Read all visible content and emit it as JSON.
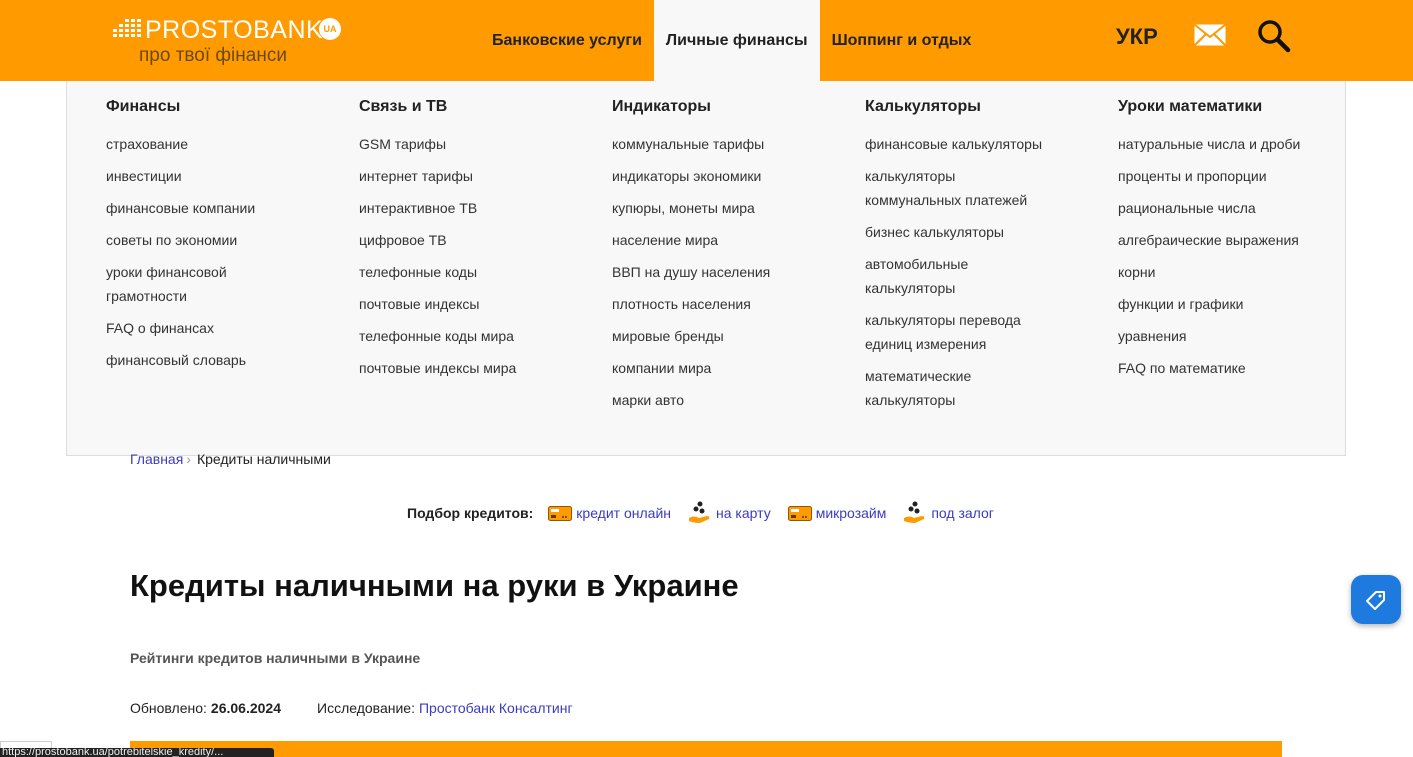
{
  "header": {
    "logo_text": "PROSTOBANK",
    "logo_badge": "UA",
    "slogan": "про твої фінанси",
    "nav": [
      {
        "label": "Банковские услуги",
        "active": false
      },
      {
        "label": "Личные финансы",
        "active": true
      },
      {
        "label": "Шоппинг и отдых",
        "active": false
      }
    ],
    "lang": "УКР",
    "colors": {
      "brand": "#ff9a00",
      "link": "#3b3bbf",
      "fab": "#1f7ae0"
    }
  },
  "mega": {
    "columns": [
      {
        "title": "Финансы",
        "links": [
          "страхование",
          "инвестиции",
          "финансовые компании",
          "советы по экономии",
          "уроки финансовой грамотности",
          "FAQ о финансах",
          "финансовый словарь"
        ]
      },
      {
        "title": "Связь и ТВ",
        "links": [
          "GSM тарифы",
          "интернет тарифы",
          "интерактивное ТВ",
          "цифровое ТВ",
          "телефонные коды",
          "почтовые индексы",
          "телефонные коды мира",
          "почтовые индексы мира"
        ]
      },
      {
        "title": "Индикаторы",
        "links": [
          "коммунальные тарифы",
          "индикаторы экономики",
          "купюры, монеты мира",
          "население мира",
          "ВВП на душу населения",
          "плотность населения",
          "мировые бренды",
          "компании мира",
          "марки авто"
        ]
      },
      {
        "title": "Калькуляторы",
        "links": [
          "финансовые калькуляторы",
          "калькуляторы коммунальных платежей",
          "бизнес калькуляторы",
          "автомобильные калькуляторы",
          "калькуляторы перевода единиц измерения",
          "математические калькуляторы"
        ]
      },
      {
        "title": "Уроки математики",
        "links": [
          "натуральные числа и дроби",
          "проценты и пропорции",
          "рациональные числа",
          "алгебраические выражения",
          "корни",
          "функции и графики",
          "уравнения",
          "FAQ по математике"
        ]
      }
    ]
  },
  "breadcrumb": {
    "home": "Главная",
    "sep": "›",
    "current": "Кредиты наличными"
  },
  "filters": {
    "label": "Подбор кредитов:",
    "items": [
      {
        "label": "кредит онлайн",
        "icon": "credit-card-icon"
      },
      {
        "label": "на карту",
        "icon": "hand-coins-icon"
      },
      {
        "label": "микрозайм",
        "icon": "credit-card-icon"
      },
      {
        "label": "под залог",
        "icon": "hand-coins-icon"
      }
    ]
  },
  "page": {
    "title": "Кредиты наличными на руки в Украине",
    "subtitle": "Рейтинги кредитов наличными в Украине",
    "updated_label": "Обновлено:",
    "updated_date": "26.06.2024",
    "research_label": "Исследование:",
    "research_link": "Простобанк Консалтинг"
  },
  "status_url": "https://prostobank.ua/potrebitelskie_kredity/..."
}
